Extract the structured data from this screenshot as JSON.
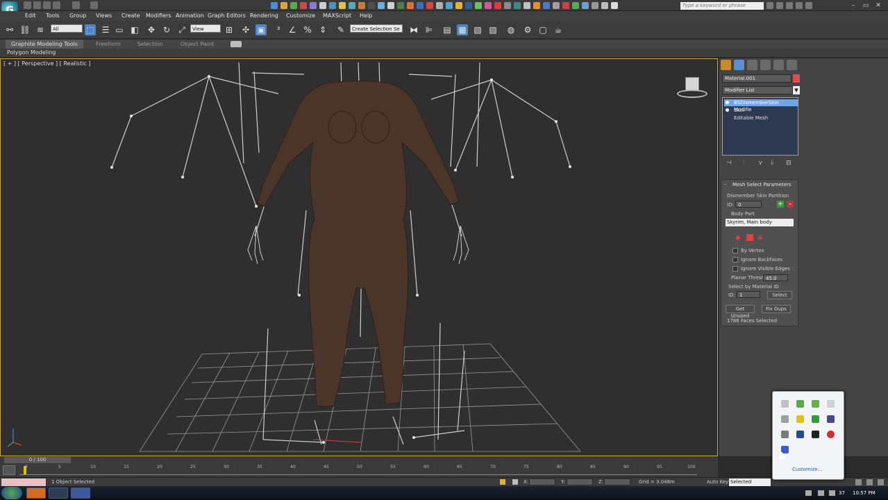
{
  "app": {
    "logo_letter": "G"
  },
  "titlebar": {
    "search_placeholder": "Type a keyword or phrase",
    "window_buttons": [
      "–",
      "▭",
      "✕"
    ]
  },
  "menubar": {
    "items": [
      "Edit",
      "Tools",
      "Group",
      "Views",
      "Create",
      "Modifiers",
      "Animation",
      "Graph Editors",
      "Rendering",
      "Customize",
      "MAXScript",
      "Help"
    ]
  },
  "toolbar": {
    "selection_filter": "All",
    "ref_coord": "View",
    "named_selection": "Create Selection Se"
  },
  "ribbon": {
    "tabs": [
      "Graphite Modeling Tools",
      "Freeform",
      "Selection",
      "Object Paint"
    ],
    "sub_label": "Polygon Modeling"
  },
  "viewport": {
    "label": "[ + ] [ Perspective ] [ Realistic ]"
  },
  "command_panel": {
    "object_name": "Material.001",
    "modifier_list_label": "Modifier List",
    "stack": [
      {
        "label": "BSDismemberSkin Modifie",
        "selected": true
      },
      {
        "label": "Skin",
        "selected": false
      },
      {
        "label": "Editable Mesh",
        "selected": false
      }
    ],
    "rollout_title": "Mesh Select Parameters",
    "dismember_label": "Dismember Skin Partition",
    "id_label": "ID:",
    "id_value": "0",
    "body_part_label": "Body Part",
    "body_part_value": "Skyrim, Main body",
    "by_vertex": "By Vertex",
    "ignore_backfaces": "Ignore Backfaces",
    "ignore_visible_edges": "Ignore Visible Edges",
    "planar_thresh_label": "Planar Thresh:",
    "planar_thresh_value": "45.0",
    "select_by_material_label": "Select by Material ID",
    "mat_id_label": "ID:",
    "mat_id_value": "1",
    "select_button": "Select",
    "get_unused_button": "Get Unused",
    "fix_dups_button": "Fix Dups",
    "faces_selected": "1786 Faces Selected"
  },
  "timeline": {
    "frame_counter": "0 / 100",
    "ticks": [
      "0",
      "5",
      "10",
      "15",
      "20",
      "25",
      "30",
      "35",
      "40",
      "45",
      "50",
      "55",
      "60",
      "65",
      "70",
      "75",
      "80",
      "85",
      "90",
      "95",
      "100"
    ]
  },
  "statusbar": {
    "selection_text": "1 Object Selected",
    "x_label": "X:",
    "y_label": "Y:",
    "z_label": "Z:",
    "grid_text": "Grid = 3.048m",
    "auto_key": "Auto Key",
    "key_mode": "Selected"
  },
  "tray_popup": {
    "customize_label": "Customize..."
  },
  "taskbar": {
    "time": "10:57 PM",
    "temp": "37"
  }
}
